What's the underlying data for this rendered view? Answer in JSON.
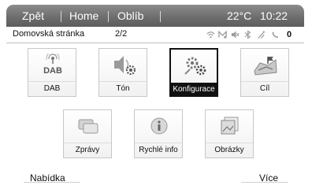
{
  "topbar": {
    "back_label": "Zpět",
    "home_label": "Home",
    "favorites_label": "Oblíb",
    "temperature": "22°C",
    "time": "10:22"
  },
  "status": {
    "page_title": "Domovská stránka",
    "page_indicator": "2/2",
    "icons": [
      "wifi-icon",
      "messages-icon",
      "mute-icon",
      "bluetooth-icon",
      "network-icon",
      "phone-icon",
      "battery-icon"
    ],
    "battery_text": "0"
  },
  "tiles": [
    {
      "label": "DAB",
      "icon": "dab-radio-icon",
      "icon_text": "DAB",
      "selected": false
    },
    {
      "label": "Tón",
      "icon": "tone-settings-icon",
      "selected": false
    },
    {
      "label": "Konfigurace",
      "icon": "configuration-icon",
      "selected": true
    },
    {
      "label": "Cíl",
      "icon": "destination-map-icon",
      "selected": false
    },
    {
      "label": "Zprávy",
      "icon": "messages-icon",
      "selected": false
    },
    {
      "label": "Rychlé info",
      "icon": "info-icon",
      "selected": false
    },
    {
      "label": "Obrázky",
      "icon": "pictures-icon",
      "selected": false
    }
  ],
  "bottombar": {
    "menu_label": "Nabídka",
    "more_label": "Více"
  }
}
